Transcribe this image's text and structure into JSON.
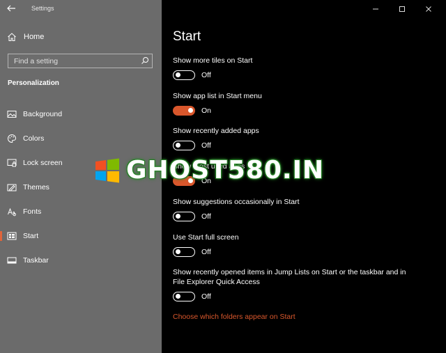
{
  "window": {
    "title": "Settings",
    "controls": [
      "minimize",
      "maximize",
      "close"
    ]
  },
  "sidebar": {
    "home_label": "Home",
    "search_placeholder": "Find a setting",
    "section_title": "Personalization",
    "items": [
      {
        "label": "Background",
        "icon": "background-icon",
        "active": false
      },
      {
        "label": "Colors",
        "icon": "palette-icon",
        "active": false
      },
      {
        "label": "Lock screen",
        "icon": "lock-screen-icon",
        "active": false
      },
      {
        "label": "Themes",
        "icon": "themes-icon",
        "active": false
      },
      {
        "label": "Fonts",
        "icon": "fonts-icon",
        "active": false
      },
      {
        "label": "Start",
        "icon": "start-icon",
        "active": true
      },
      {
        "label": "Taskbar",
        "icon": "taskbar-icon",
        "active": false
      }
    ]
  },
  "main": {
    "title": "Start",
    "settings": [
      {
        "label": "Show more tiles on Start",
        "state": "Off",
        "on": false
      },
      {
        "label": "Show app list in Start menu",
        "state": "On",
        "on": true
      },
      {
        "label": "Show recently added apps",
        "state": "Off",
        "on": false
      },
      {
        "label": "Show most used apps",
        "state": "On",
        "on": true
      },
      {
        "label": "Show suggestions occasionally in Start",
        "state": "Off",
        "on": false
      },
      {
        "label": "Use Start full screen",
        "state": "Off",
        "on": false
      },
      {
        "label": "Show recently opened items in Jump Lists on Start or the taskbar and in File Explorer Quick Access",
        "state": "Off",
        "on": false
      }
    ],
    "link_text": "Choose which folders appear on Start"
  },
  "watermark": {
    "text": "GHOST580.IN"
  },
  "colors": {
    "accent": "#d9572c",
    "sidebar_bg": "#6b6b6b",
    "main_bg": "#000000"
  }
}
